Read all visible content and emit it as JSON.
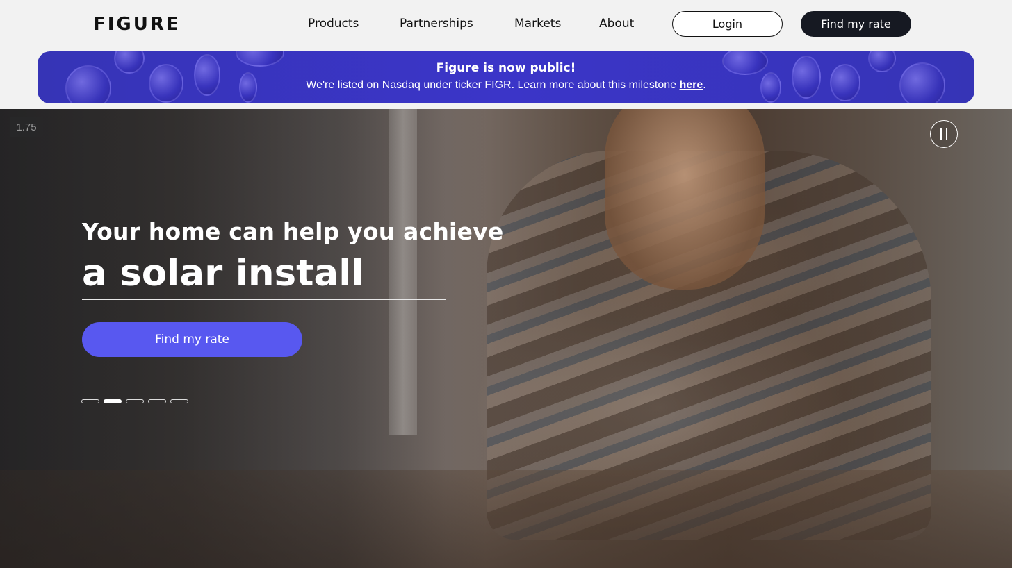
{
  "header": {
    "logo": "FIGURE",
    "nav": [
      {
        "label": "Products"
      },
      {
        "label": "Partnerships"
      },
      {
        "label": "Markets"
      },
      {
        "label": "About"
      }
    ],
    "login_label": "Login",
    "find_rate_label": "Find my rate"
  },
  "banner": {
    "title": "Figure is now public!",
    "text": "We're listed on Nasdaq under ticker FIGR. Learn more about this milestone ",
    "link_label": "here",
    "suffix": ".",
    "color": "#3b35c8"
  },
  "hero": {
    "speed_label": "1.75",
    "headline": "Your home can help you achieve",
    "highlight": "a solar install",
    "cta_label": "Find my rate",
    "cta_color": "#5858f0",
    "slides_total": 5,
    "active_slide": 2
  },
  "icons": {
    "pause": "pause-icon"
  }
}
